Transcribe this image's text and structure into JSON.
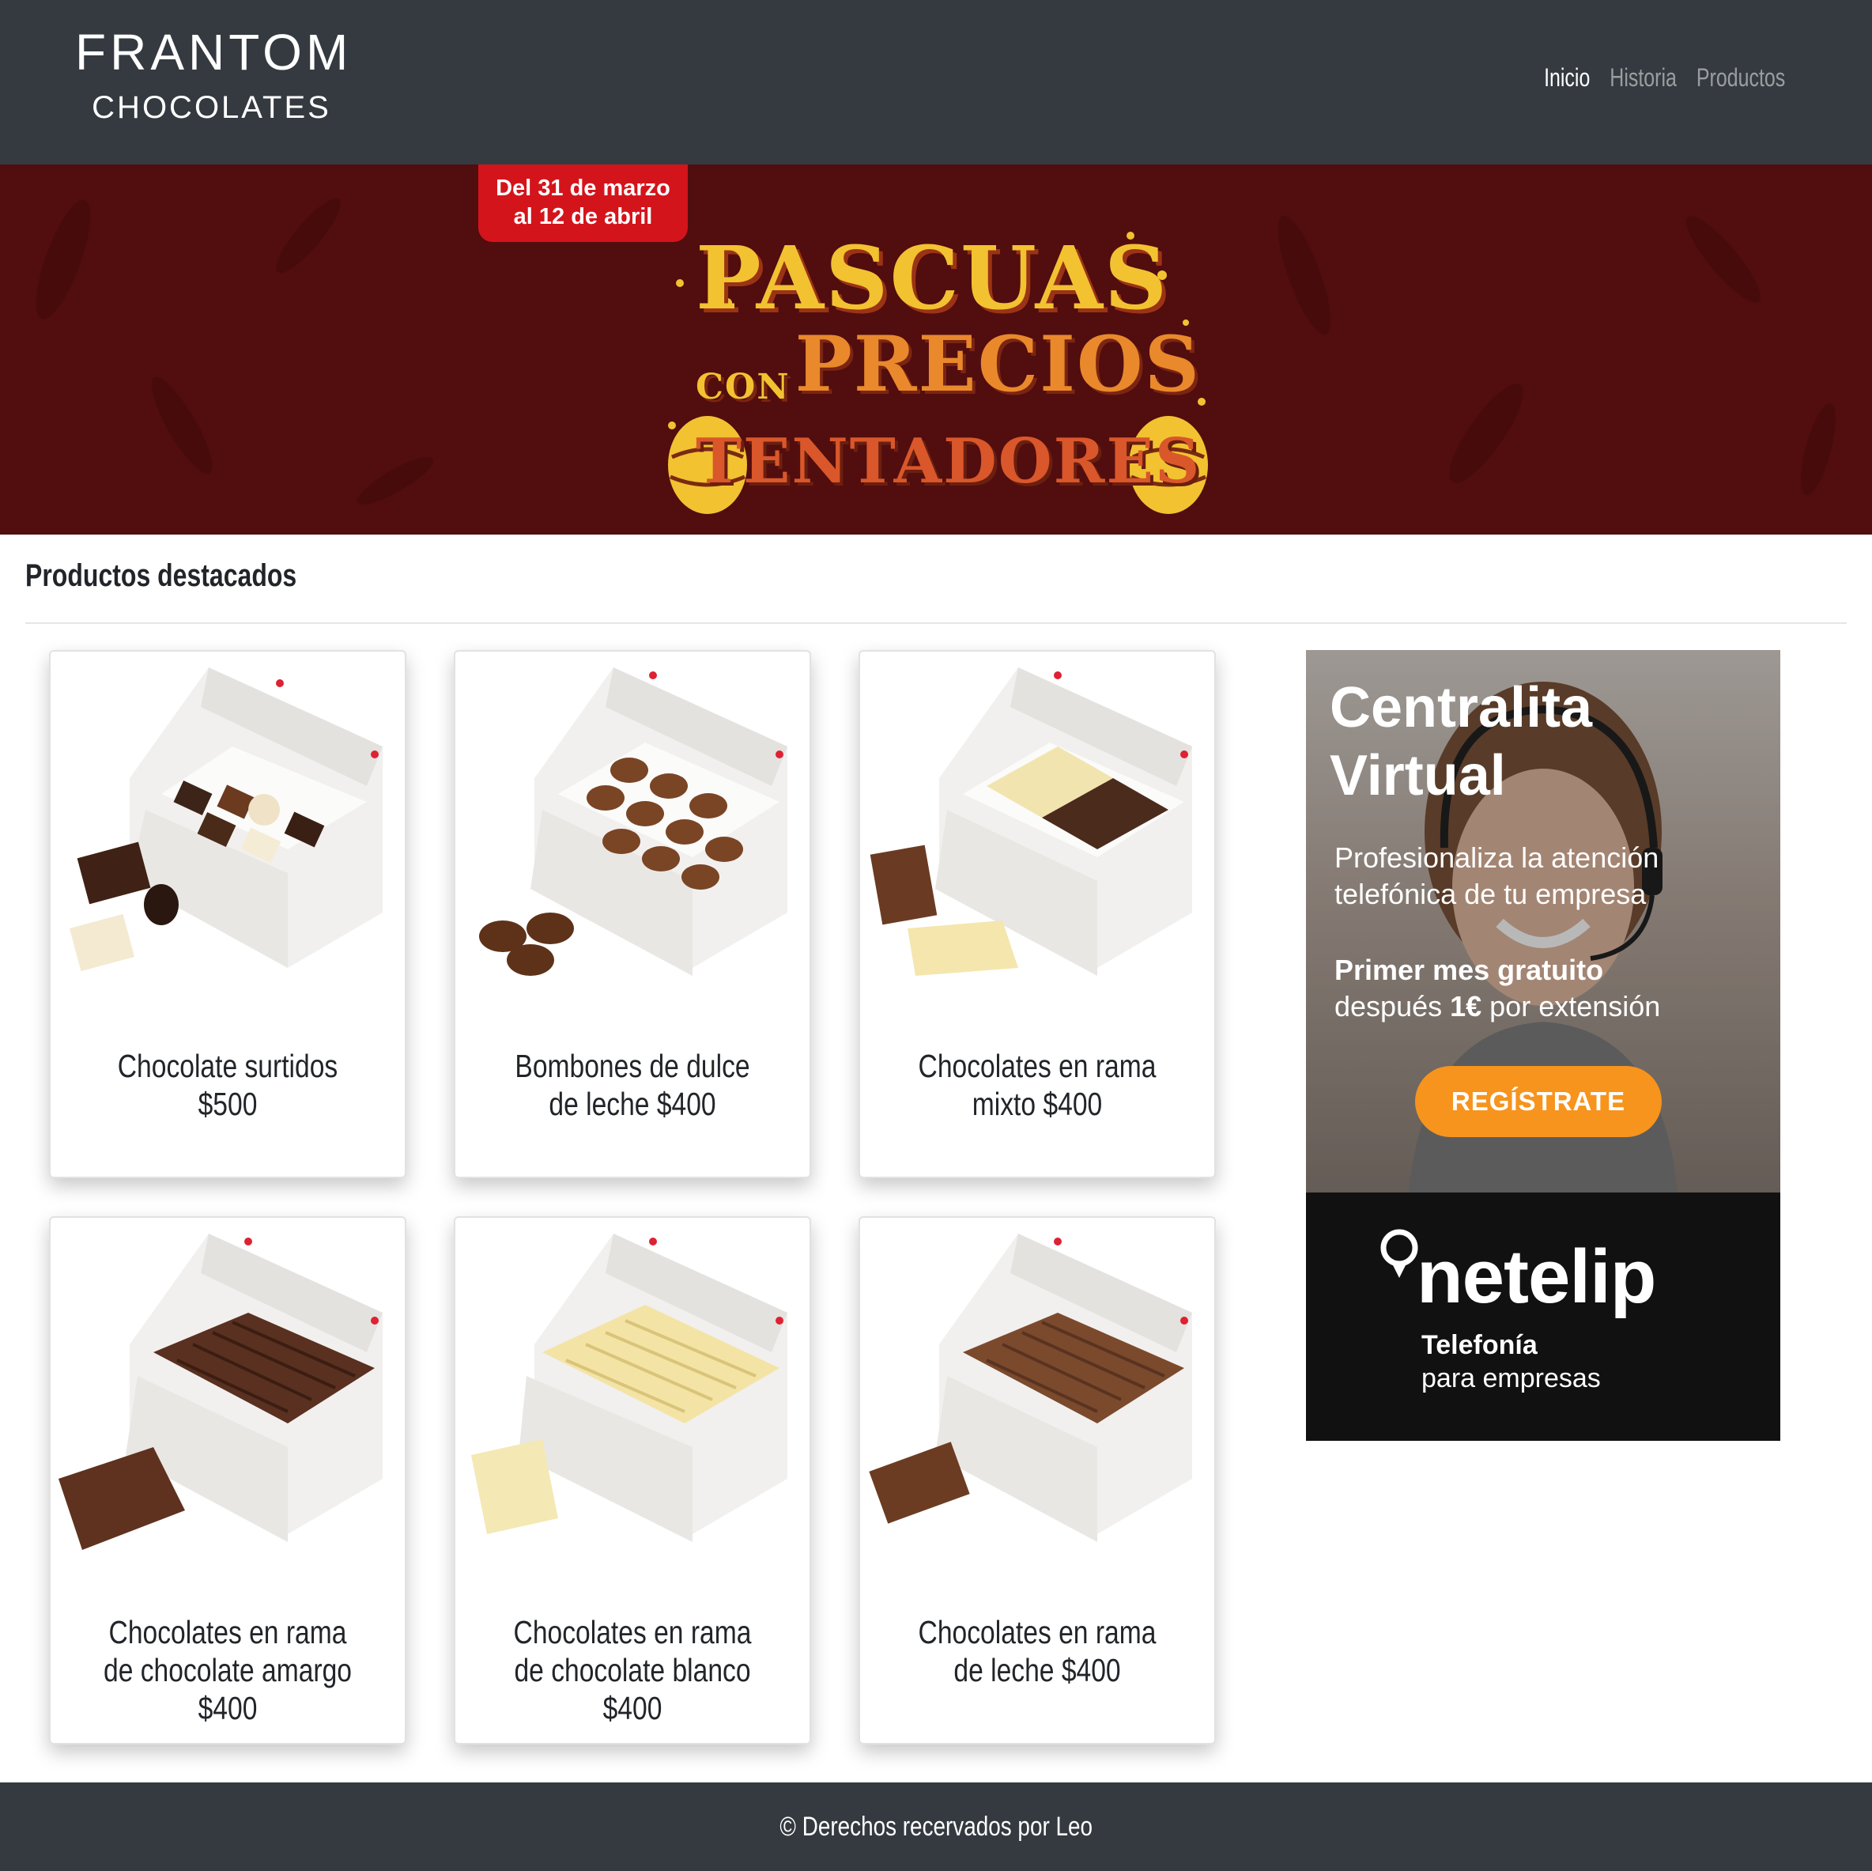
{
  "header": {
    "brand_line1": "FRANTOM",
    "brand_line2": "CHOCOLATES",
    "nav": [
      {
        "label": "Inicio",
        "active": true
      },
      {
        "label": "Historia",
        "active": false
      },
      {
        "label": "Productos",
        "active": false
      }
    ]
  },
  "banner": {
    "badge_line1": "Del 31 de marzo",
    "badge_line2": "al 12 de abril",
    "title_line1": "PASCUAS",
    "title_con": "CON",
    "title_line2": "PRECIOS",
    "title_line3": "TENTADORES"
  },
  "section": {
    "title": "Productos destacados"
  },
  "products": [
    {
      "caption": "Chocolate surtidos $500"
    },
    {
      "caption": "Bombones de dulce de leche $400"
    },
    {
      "caption": "Chocolates en rama mixto $400"
    },
    {
      "caption": "Chocolates en rama de chocolate amargo $400"
    },
    {
      "caption": "Chocolates en rama de chocolate blanco $400"
    },
    {
      "caption": "Chocolates en rama de leche $400"
    }
  ],
  "ad": {
    "headline_line1": "Centralita",
    "headline_line2": "Virtual",
    "sub_line1": "Profesionaliza la atención",
    "sub_line2": "telefónica de tu empresa",
    "offer_bold": "Primer mes gratuito",
    "offer_line2_pre": "después ",
    "offer_line2_bold": "1€",
    "offer_line2_post": " por extensión",
    "cta": "REGÍSTRATE",
    "brand": "netelip",
    "brand_tag1": "Telefonía",
    "brand_tag2": "para empresas"
  },
  "footer": {
    "text": "© Derechos recervados por Leo"
  },
  "colors": {
    "navbar": "#343a40",
    "banner_bg": "#520d0e",
    "badge": "#d4141b",
    "cta": "#f7941d"
  }
}
